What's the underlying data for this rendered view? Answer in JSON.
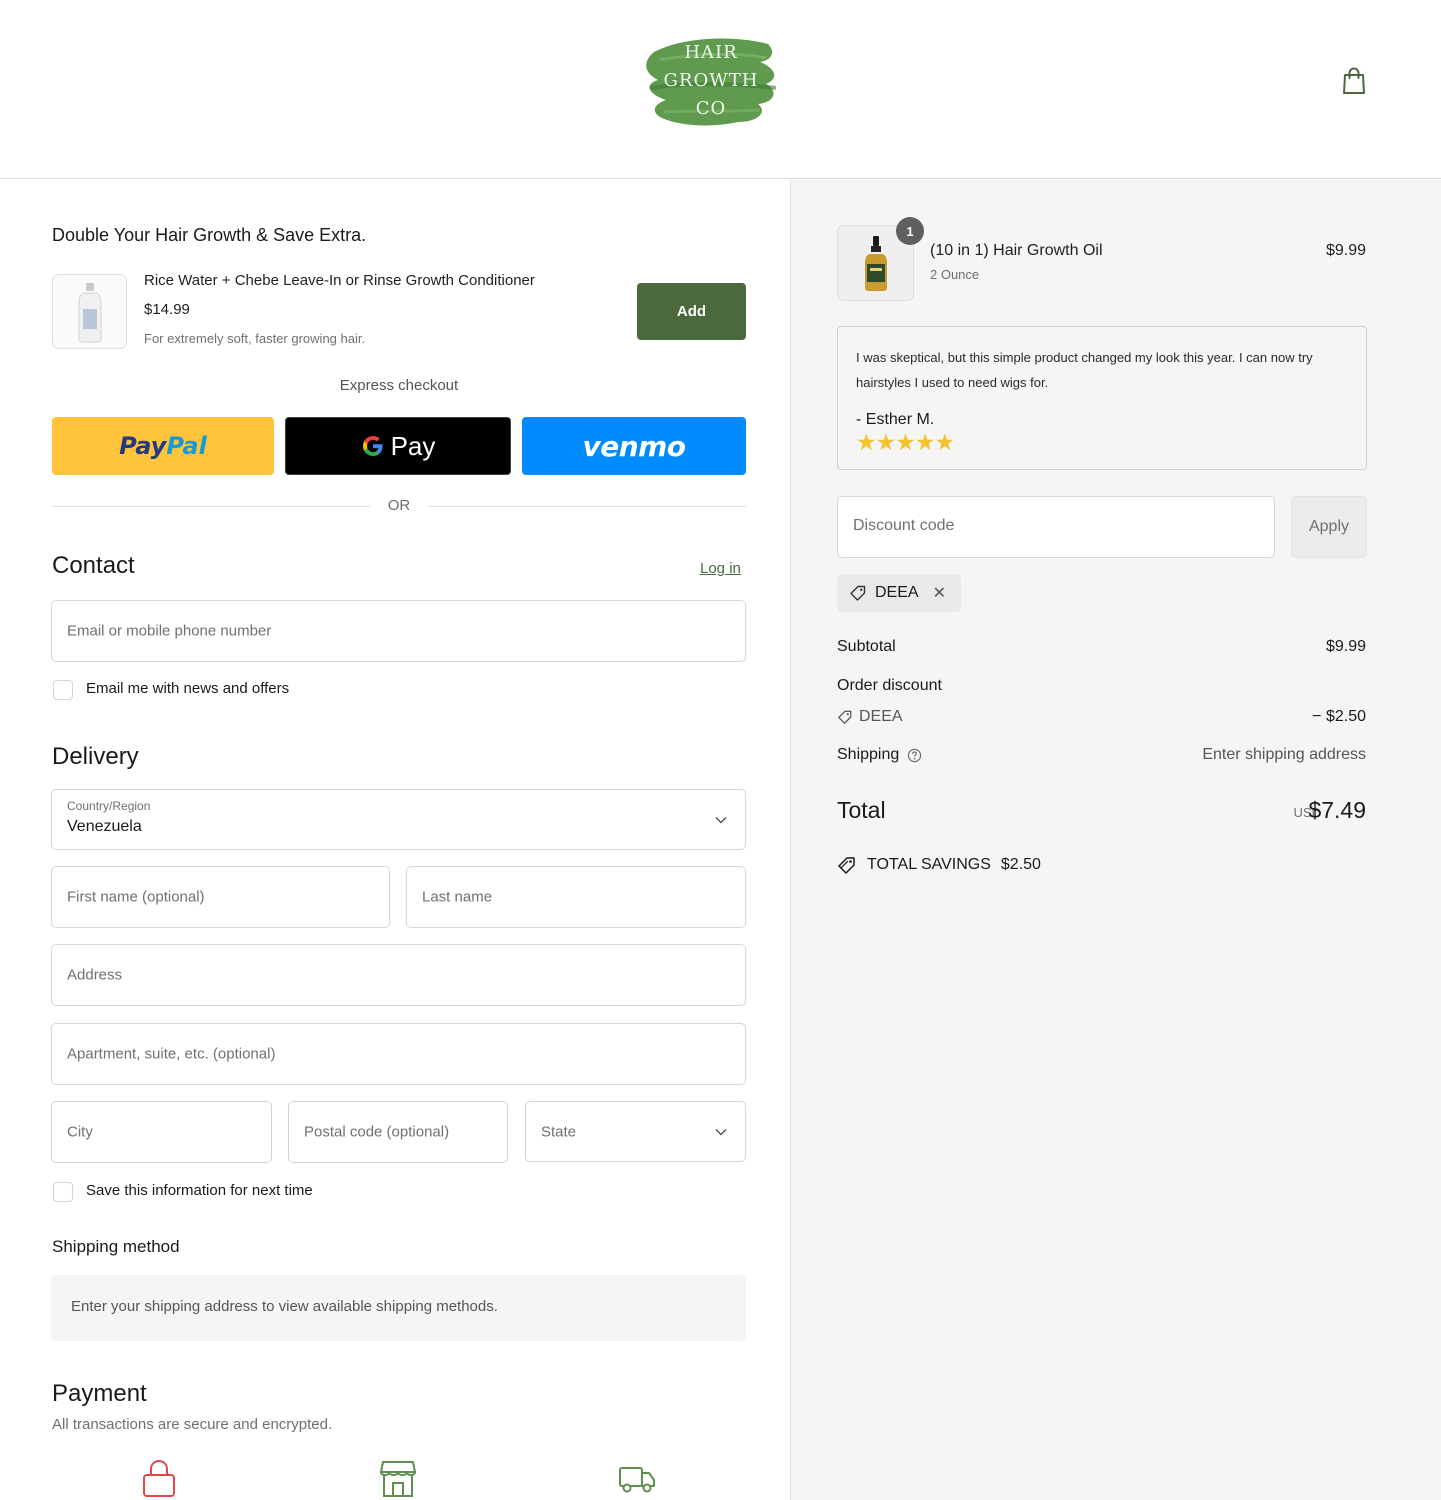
{
  "brand": {
    "logo_line1": "HAIR",
    "logo_line2": "GROWTH",
    "logo_line3": "CO",
    "accent_color": "#4a6a3e"
  },
  "header": {
    "cart_icon": "shopping-bag-icon"
  },
  "upsell": {
    "title": "Double Your Hair Growth & Save Extra.",
    "product_name": "Rice Water + Chebe Leave-In or Rinse Growth Conditioner",
    "price": "$14.99",
    "description": "For extremely soft, faster growing hair.",
    "add_label": "Add"
  },
  "express": {
    "label": "Express checkout",
    "paypal_part1": "Pay",
    "paypal_part2": "Pal",
    "gpay_g": "G",
    "gpay_label": "Pay",
    "venmo_label": "venmo",
    "or_label": "OR"
  },
  "contact": {
    "title": "Contact",
    "login_label": "Log in",
    "email_placeholder": "Email or mobile phone number",
    "news_label": "Email me with news and offers"
  },
  "delivery": {
    "title": "Delivery",
    "country_label": "Country/Region",
    "country_value": "Venezuela",
    "first_name_placeholder": "First name (optional)",
    "last_name_placeholder": "Last name",
    "address_placeholder": "Address",
    "apartment_placeholder": "Apartment, suite, etc. (optional)",
    "city_placeholder": "City",
    "postal_placeholder": "Postal code (optional)",
    "state_placeholder": "State",
    "save_info_label": "Save this information for next time"
  },
  "shipping_method": {
    "title": "Shipping method",
    "notice": "Enter your shipping address to view available shipping methods."
  },
  "payment": {
    "title": "Payment",
    "subtitle": "All transactions are secure and encrypted."
  },
  "order": {
    "item_quantity": "1",
    "item_name": "(10 in 1) Hair Growth Oil",
    "item_variant": "2 Ounce",
    "item_price": "$9.99"
  },
  "review": {
    "text": "I was skeptical, but this simple product changed my look this year. I can now try hairstyles I used to need wigs for.",
    "author": "- Esther M.",
    "stars": "★★★★★",
    "rating": 5
  },
  "discount": {
    "placeholder": "Discount code",
    "apply_label": "Apply",
    "applied_code": "DEEA"
  },
  "summary": {
    "subtotal_label": "Subtotal",
    "subtotal_value": "$9.99",
    "order_discount_label": "Order discount",
    "discount_code": "DEEA",
    "discount_value": "− $2.50",
    "shipping_label": "Shipping",
    "shipping_value": "Enter shipping address",
    "total_label": "Total",
    "total_currency": "USD",
    "total_value": "$7.49",
    "savings_label": "TOTAL SAVINGS",
    "savings_value": "$2.50"
  }
}
